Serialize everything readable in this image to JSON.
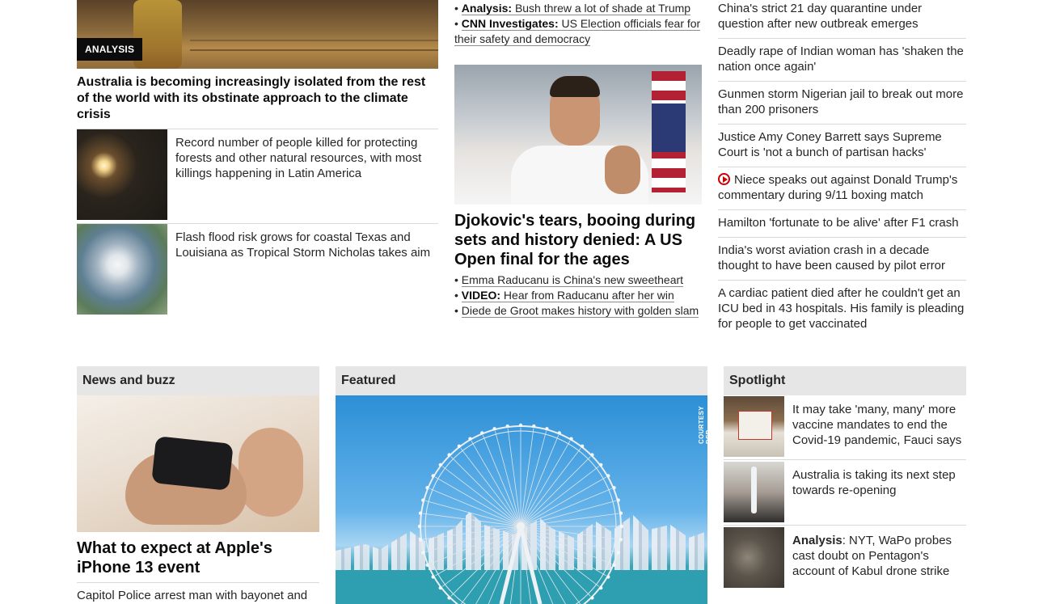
{
  "col1": {
    "hero_tag": "ANALYSIS",
    "hero_headline": "Australia is becoming increasingly isolated from the rest of the world with its obstinate approach to the climate crisis",
    "stories": [
      {
        "text": "Record number of people killed for protecting forests and other natural resources, with most killings happening in Latin America"
      },
      {
        "text": "Flash flood risk grows for coastal Texas and Louisiana as Tropical Storm Nicholas takes aim"
      }
    ]
  },
  "col2": {
    "top_links": [
      {
        "prefix": "Analysis:",
        "text": "Bush threw a lot of shade at Trump"
      },
      {
        "prefix": "CNN Investigates:",
        "text": "US Election officials fear for their safety and democracy"
      }
    ],
    "headline": "Djokovic's tears, booing during sets and history denied: A US Open final for the ages",
    "links": [
      {
        "prefix": "",
        "text": "Emma Raducanu is China's new sweetheart"
      },
      {
        "prefix": "VIDEO:",
        "text": "Hear from Raducanu after her win"
      },
      {
        "prefix": "",
        "text": "Diede de Groot makes history with golden slam"
      }
    ]
  },
  "col3": {
    "items": [
      {
        "text": "China's strict 21 day quarantine under question after new outbreak emerges"
      },
      {
        "text": "Deadly rape of Indian woman has 'shaken the nation once again'"
      },
      {
        "text": "Gunmen storm Nigerian jail to break out more than 200 prisoners"
      },
      {
        "text": "Justice Amy Coney Barrett says Supreme Court is 'not a bunch of partisan hacks'"
      },
      {
        "text": "Niece speaks out against Donald Trump's commentary during 9/11 boxing match"
      },
      {
        "text": "Hamilton 'fortunate to be alive' after F1 crash"
      },
      {
        "text": "India's worst aviation crash in a decade thought to have been caused by pilot error"
      },
      {
        "text": "A cardiac patient died after he couldn't get an ICU bed in 43 hospitals. His family is pleading for people to get vaccinated"
      }
    ]
  },
  "buzz": {
    "title": "News and buzz",
    "headline": "What to expect at Apple's iPhone 13 event",
    "sub": "Capitol Police arrest man with bayonet and"
  },
  "featured": {
    "title": "Featured",
    "credit": "COURTESY DSP"
  },
  "spotlight": {
    "title": "Spotlight",
    "items": [
      {
        "bold": "",
        "text": "It may take 'many, many' more vaccine mandates to end the Covid-19 pandemic, Fauci says"
      },
      {
        "bold": "",
        "text": "Australia is taking its next step towards re-opening"
      },
      {
        "bold": "Analysis",
        "text": ": NYT, WaPo probes cast doubt on Pentagon's account of Kabul drone strike"
      }
    ]
  },
  "colors": {
    "accent_red": "#cc0000",
    "text": "#0c0c0c",
    "header_bg": "#e6e6e6"
  },
  "icons": {
    "video": "play-circle-icon"
  }
}
